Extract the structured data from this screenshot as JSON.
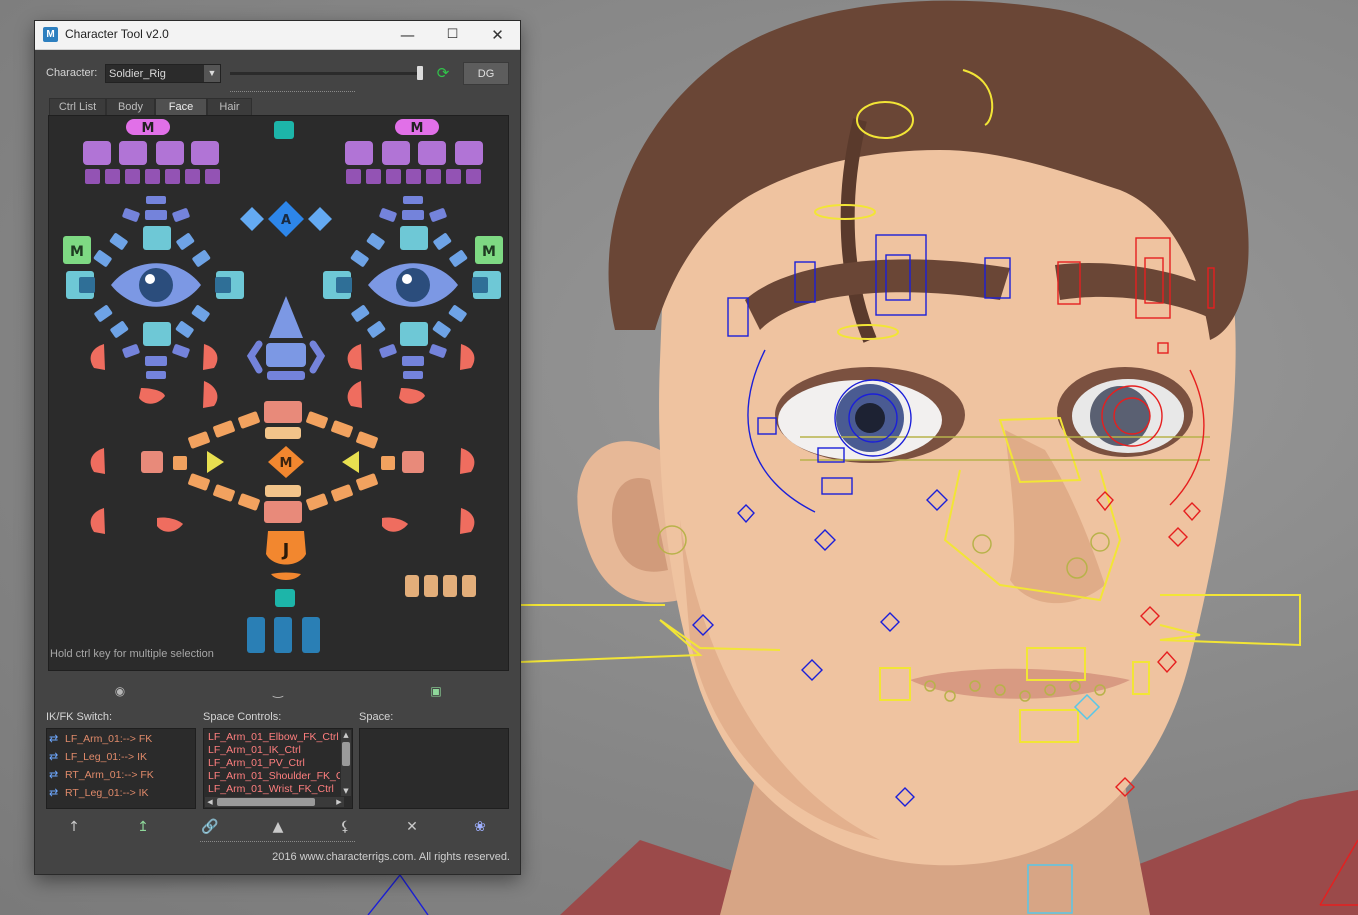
{
  "window": {
    "title": "Character Tool v2.0",
    "app_icon_letter": "M",
    "minimize_glyph": "—",
    "maximize_glyph": "☐",
    "close_glyph": "✕"
  },
  "toolbar": {
    "character_label": "Character:",
    "character_value": "Soldier_Rig",
    "dropdown_glyph": "▼",
    "refresh_glyph": "⟳",
    "dg_label": "DG"
  },
  "tabs": [
    "Ctrl List",
    "Body",
    "Face",
    "Hair"
  ],
  "active_tab": "Face",
  "face_picker": {
    "left_mirror_label": "M",
    "right_mirror_label": "M",
    "left_side_label": "M",
    "right_side_label": "M",
    "center_label": "A",
    "mouth_label": "M",
    "jaw_label": "J",
    "hint": "Hold ctrl key for multiple selection"
  },
  "ikfk": {
    "label": "IK/FK Switch:",
    "items": [
      "LF_Arm_01:--> FK",
      "LF_Leg_01:--> IK",
      "RT_Arm_01:--> FK",
      "RT_Leg_01:--> IK"
    ]
  },
  "space_controls": {
    "label": "Space Controls:",
    "items": [
      "LF_Arm_01_Elbow_FK_Ctrl",
      "LF_Arm_01_IK_Ctrl",
      "LF_Arm_01_PV_Ctrl",
      "LF_Arm_01_Shoulder_FK_C",
      "LF_Arm_01_Wrist_FK_Ctrl"
    ]
  },
  "space": {
    "label": "Space:"
  },
  "footer": {
    "copyright": "2016 www.characterrigs.com. All rights reserved."
  },
  "colors": {
    "panel_bg": "#444444",
    "canvas_bg": "#2b2b2b",
    "lavender": "#b174d6",
    "periwinkle": "#7483db",
    "cyan": "#6ec8d6",
    "coral": "#ef6d5f",
    "orange": "#f2a25f",
    "teal": "#1db5a9",
    "blue": "#2a7fb5",
    "green": "#7ed983",
    "pink_mirror": "#e170e8"
  }
}
